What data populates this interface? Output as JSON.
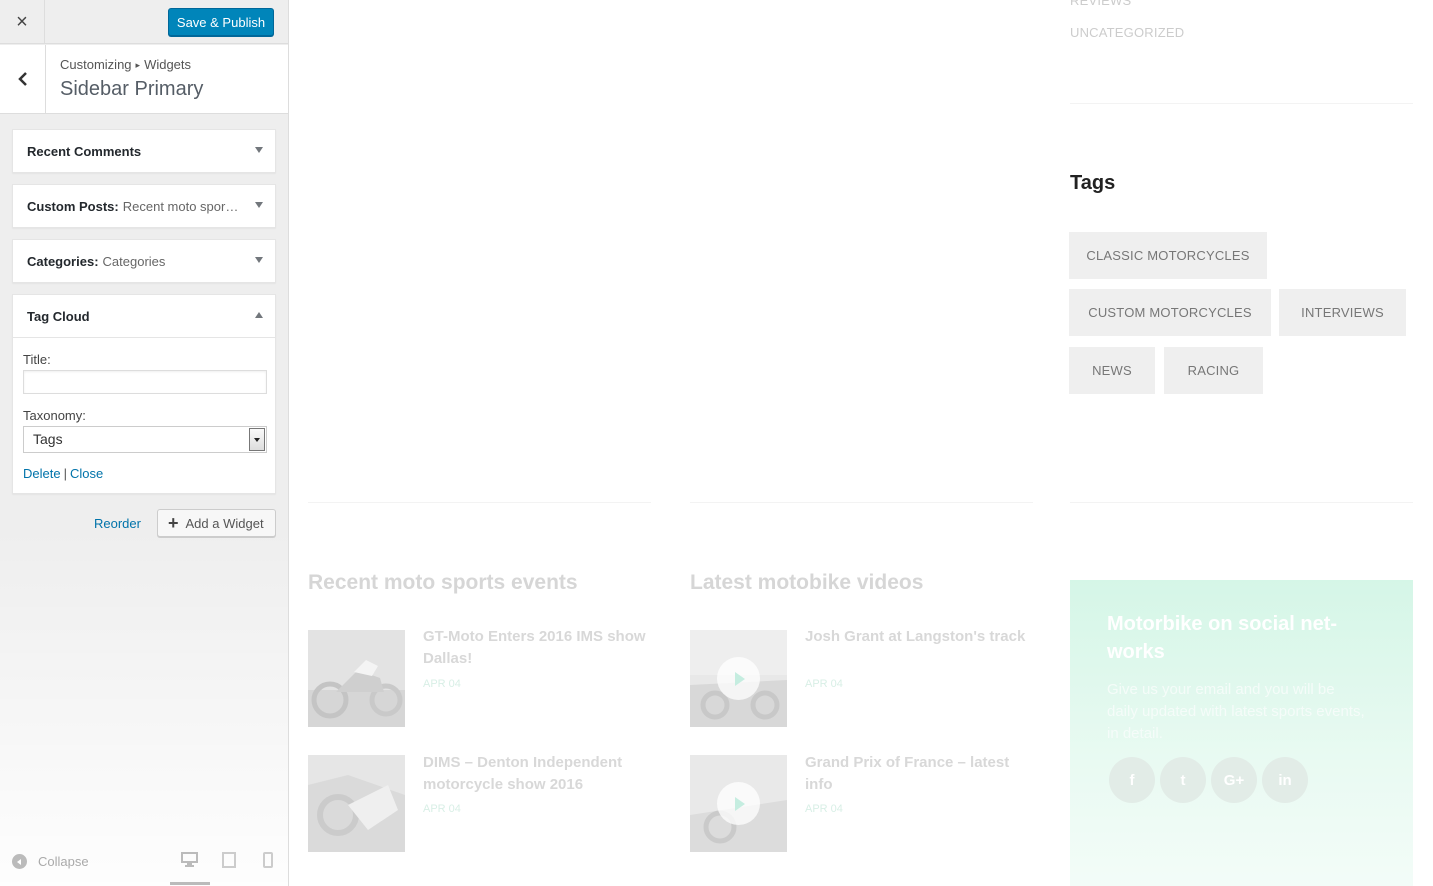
{
  "header": {
    "close_label": "×",
    "save_label": "Save & Publish"
  },
  "section": {
    "breadcrumb_root": "Customizing",
    "breadcrumb_sep": "▸",
    "breadcrumb_current": "Widgets",
    "title": "Sidebar Primary"
  },
  "widgets": [
    {
      "name": "Recent Comments",
      "subtitle": ""
    },
    {
      "name": "Custom Posts:",
      "subtitle": "Recent moto sports events"
    },
    {
      "name": "Categories:",
      "subtitle": "Categories"
    },
    {
      "name": "Tag Cloud",
      "subtitle": "",
      "expanded": true,
      "fields": {
        "title_label": "Title:",
        "title_value": "",
        "taxonomy_label": "Taxonomy:",
        "taxonomy_value": "Tags"
      },
      "delete_label": "Delete",
      "separator": "|",
      "close_label": "Close"
    }
  ],
  "actions": {
    "reorder_label": "Reorder",
    "add_widget_label": "Add a Widget"
  },
  "footer": {
    "collapse_label": "Collapse",
    "devices": [
      "desktop-icon",
      "tablet-icon",
      "mobile-icon"
    ],
    "active_device": "desktop"
  },
  "preview": {
    "categories_faded": [
      "REVIEWS",
      "UNCATEGORIZED"
    ],
    "tags_title": "Tags",
    "tags": [
      "CLASSIC MOTORCYCLES",
      "CUSTOM MOTORCYCLES",
      "INTERVIEWS",
      "NEWS",
      "RACING"
    ],
    "recent_events": {
      "title": "Recent moto sports events",
      "posts": [
        {
          "title": "GT-Moto Enters 2016 IMS show Dallas!",
          "date": "APR 04"
        },
        {
          "title": "DIMS – Denton Independent motorcycle show 2016",
          "date": "APR 04"
        }
      ]
    },
    "latest_videos": {
      "title": "Latest motobike videos",
      "posts": [
        {
          "title": "Josh Grant at Langston's track",
          "date": "APR 04"
        },
        {
          "title": "Grand Prix of France – latest info",
          "date": "APR 04"
        }
      ]
    },
    "social": {
      "title": "Motorbike on social net-works",
      "text": "Give us your email and you will be daily updated with latest sports events, in detail.",
      "icons": [
        "f",
        "t",
        "G+",
        "in"
      ],
      "accent_color": "#d5f6e7"
    }
  },
  "colors": {
    "primary_button": "#0085ba",
    "link": "#0073aa"
  }
}
